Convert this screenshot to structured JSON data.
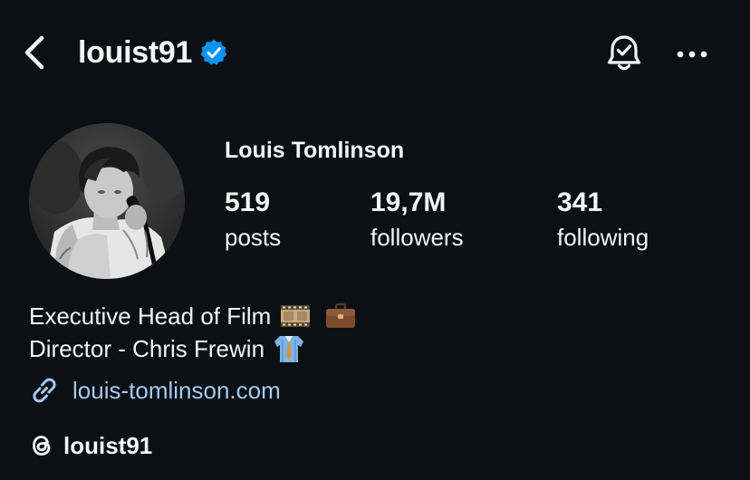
{
  "header": {
    "username": "louist91",
    "back_icon": "chevron-left-icon",
    "verified_icon": "verified-badge-icon",
    "bell_icon": "notification-bell-check-icon",
    "more_icon": "more-horizontal-icon"
  },
  "profile": {
    "full_name": "Louis Tomlinson",
    "stats": [
      {
        "value": "519",
        "label": "posts"
      },
      {
        "value": "19,7M",
        "label": "followers"
      },
      {
        "value": "341",
        "label": "following"
      }
    ],
    "bio_lines": [
      "Executive Head of Film",
      "Director - Chris Frewin"
    ],
    "link": "louis-tomlinson.com",
    "threads_handle": "louist91"
  },
  "colors": {
    "background": "#0c1014",
    "text": "#f5f5f5",
    "link": "#a8c8f0",
    "verified": "#0095f6"
  }
}
